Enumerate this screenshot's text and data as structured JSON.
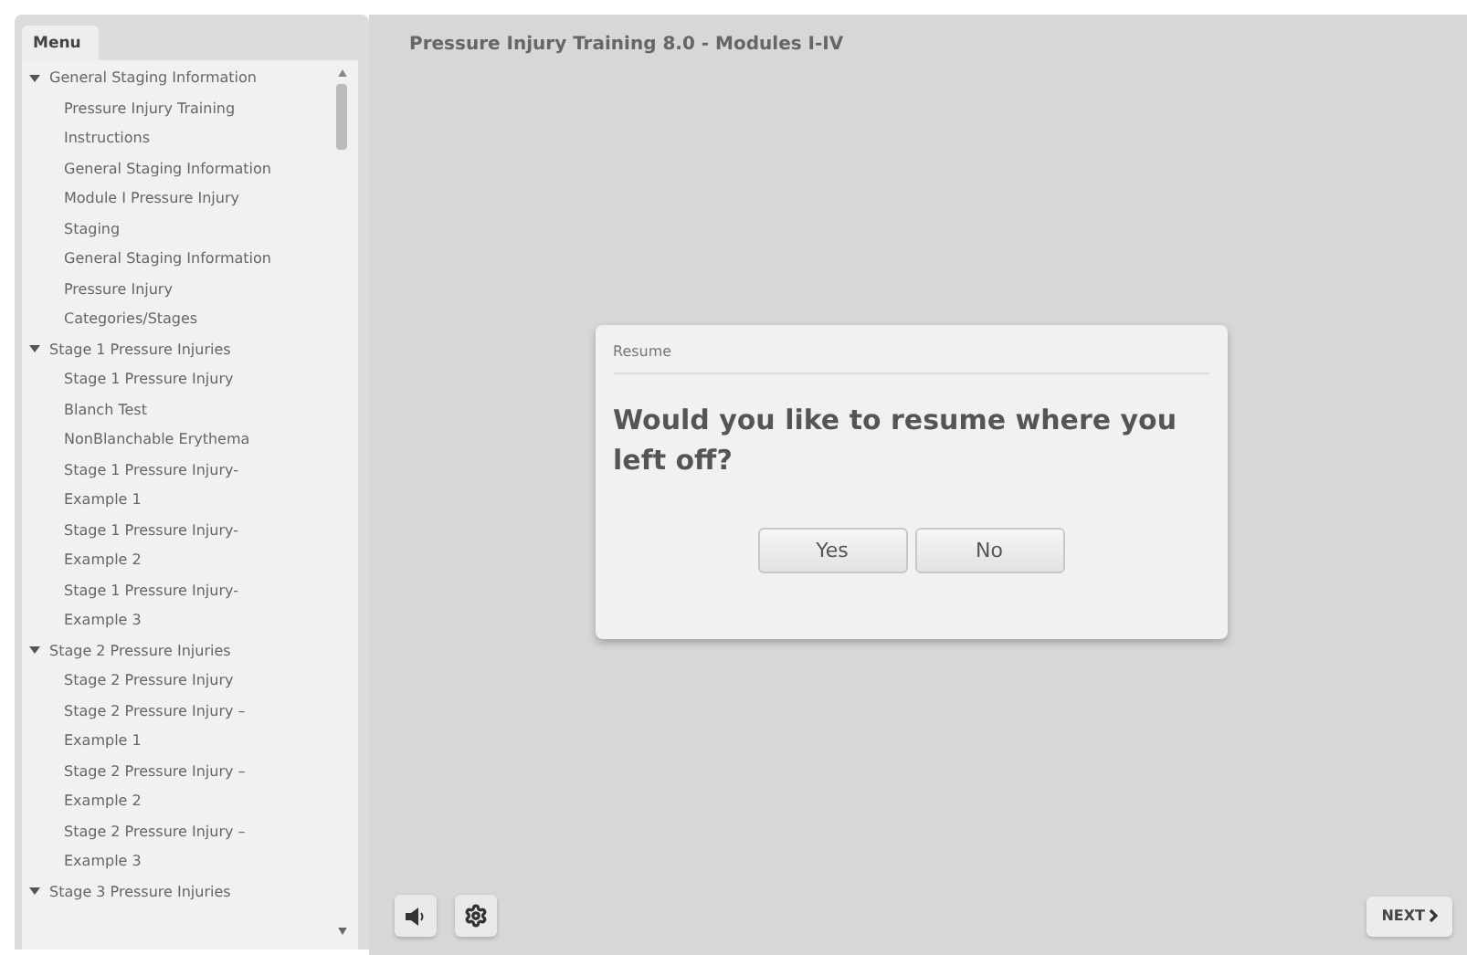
{
  "menu": {
    "title": "Menu",
    "sections": [
      {
        "label": "General Staging Information",
        "expanded": true,
        "children": [
          {
            "label": "Pressure Injury Training Instructions"
          },
          {
            "label": "General Staging Information"
          },
          {
            "label": "Module I Pressure Injury Staging"
          },
          {
            "label": "General Staging Information"
          },
          {
            "label": "Pressure Injury Categories/Stages"
          }
        ]
      },
      {
        "label": "Stage 1 Pressure Injuries",
        "expanded": true,
        "children": [
          {
            "label": "Stage 1 Pressure Injury"
          },
          {
            "label": "Blanch Test"
          },
          {
            "label": "NonBlanchable Erythema"
          },
          {
            "label": "Stage 1 Pressure Injury-Example 1"
          },
          {
            "label": "Stage 1 Pressure Injury-Example 2"
          },
          {
            "label": "Stage 1 Pressure Injury-Example 3"
          }
        ]
      },
      {
        "label": "Stage 2 Pressure Injuries",
        "expanded": true,
        "children": [
          {
            "label": "Stage 2 Pressure Injury"
          },
          {
            "label": "Stage 2 Pressure Injury – Example 1"
          },
          {
            "label": "Stage 2 Pressure Injury – Example 2"
          },
          {
            "label": "Stage 2 Pressure Injury – Example 3"
          }
        ]
      },
      {
        "label": "Stage 3 Pressure Injuries",
        "expanded": true
      }
    ]
  },
  "title": "Pressure Injury Training 8.0 - Modules I-IV",
  "dialog": {
    "title": "Resume",
    "message": "Would you like to resume where you left off?",
    "buttons": [
      "Yes",
      "No"
    ]
  },
  "next_button": "NEXT"
}
